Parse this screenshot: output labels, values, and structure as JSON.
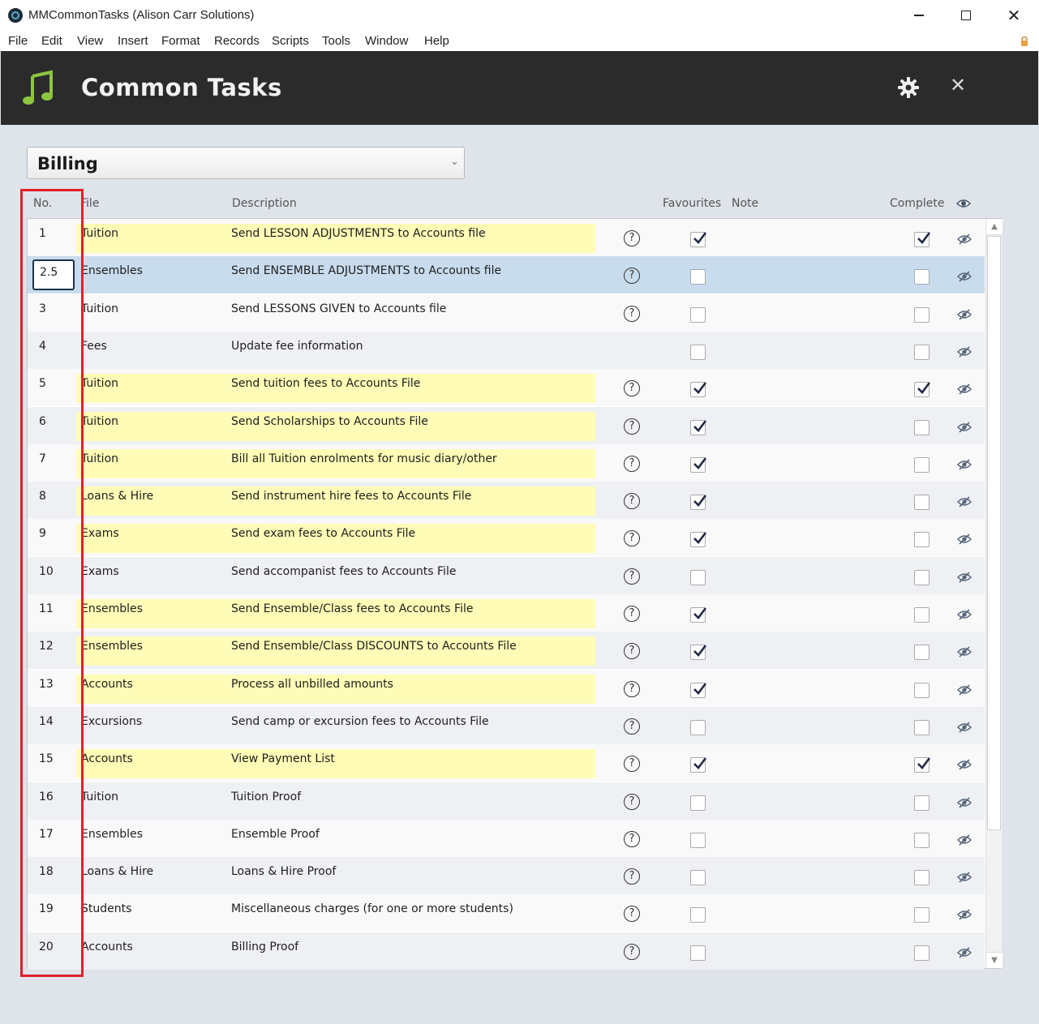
{
  "window": {
    "title": "MMCommonTasks (Alison Carr Solutions)"
  },
  "menu": [
    "File",
    "Edit",
    "View",
    "Insert",
    "Format",
    "Records",
    "Scripts",
    "Tools",
    "Window",
    "Help"
  ],
  "header": {
    "title": "Common Tasks"
  },
  "category_select": {
    "value": "Billing"
  },
  "columns": {
    "no": "No.",
    "file": "File",
    "description": "Description",
    "favourites": "Favourites",
    "note": "Note",
    "complete": "Complete"
  },
  "rows": [
    {
      "no": "1",
      "file": "Tuition",
      "description": "Send LESSON ADJUSTMENTS to Accounts file",
      "highlight": true,
      "help": true,
      "favourite": true,
      "complete": true
    },
    {
      "no": "2.5",
      "file": "Ensembles",
      "description": "Send ENSEMBLE ADJUSTMENTS to Accounts file",
      "highlight": false,
      "help": true,
      "favourite": false,
      "complete": false,
      "selected": true,
      "editing": true
    },
    {
      "no": "3",
      "file": "Tuition",
      "description": "Send LESSONS GIVEN to Accounts file",
      "highlight": false,
      "help": true,
      "favourite": false,
      "complete": false
    },
    {
      "no": "4",
      "file": "Fees",
      "description": "Update fee information",
      "highlight": false,
      "help": false,
      "favourite": false,
      "complete": false
    },
    {
      "no": "5",
      "file": "Tuition",
      "description": "Send tuition fees to Accounts File",
      "highlight": true,
      "help": true,
      "favourite": true,
      "complete": true
    },
    {
      "no": "6",
      "file": "Tuition",
      "description": "Send Scholarships to Accounts File",
      "highlight": true,
      "help": true,
      "favourite": true,
      "complete": false
    },
    {
      "no": "7",
      "file": "Tuition",
      "description": "Bill all Tuition enrolments for music diary/other",
      "highlight": true,
      "help": true,
      "favourite": true,
      "complete": false
    },
    {
      "no": "8",
      "file": "Loans & Hire",
      "description": "Send instrument hire fees to Accounts File",
      "highlight": true,
      "help": true,
      "favourite": true,
      "complete": false
    },
    {
      "no": "9",
      "file": "Exams",
      "description": "Send exam fees to Accounts File",
      "highlight": true,
      "help": true,
      "favourite": true,
      "complete": false
    },
    {
      "no": "10",
      "file": "Exams",
      "description": "Send accompanist fees to Accounts File",
      "highlight": false,
      "help": true,
      "favourite": false,
      "complete": false
    },
    {
      "no": "11",
      "file": "Ensembles",
      "description": "Send Ensemble/Class fees to Accounts File",
      "highlight": true,
      "help": true,
      "favourite": true,
      "complete": false
    },
    {
      "no": "12",
      "file": "Ensembles",
      "description": "Send Ensemble/Class DISCOUNTS to Accounts File",
      "highlight": true,
      "help": true,
      "favourite": true,
      "complete": false
    },
    {
      "no": "13",
      "file": "Accounts",
      "description": "Process all unbilled amounts",
      "highlight": true,
      "help": true,
      "favourite": true,
      "complete": false
    },
    {
      "no": "14",
      "file": "Excursions",
      "description": "Send camp or excursion fees to Accounts File",
      "highlight": false,
      "help": true,
      "favourite": false,
      "complete": false
    },
    {
      "no": "15",
      "file": "Accounts",
      "description": "View Payment List",
      "highlight": true,
      "help": true,
      "favourite": true,
      "complete": true
    },
    {
      "no": "16",
      "file": "Tuition",
      "description": "Tuition Proof",
      "highlight": false,
      "help": true,
      "favourite": false,
      "complete": false
    },
    {
      "no": "17",
      "file": "Ensembles",
      "description": "Ensemble Proof",
      "highlight": false,
      "help": true,
      "favourite": false,
      "complete": false
    },
    {
      "no": "18",
      "file": "Loans & Hire",
      "description": "Loans & Hire Proof",
      "highlight": false,
      "help": true,
      "favourite": false,
      "complete": false
    },
    {
      "no": "19",
      "file": "Students",
      "description": "Miscellaneous charges (for one or more students)",
      "highlight": false,
      "help": true,
      "favourite": false,
      "complete": false
    },
    {
      "no": "20",
      "file": "Accounts",
      "description": "Billing Proof",
      "highlight": false,
      "help": true,
      "favourite": false,
      "complete": false
    }
  ],
  "icons": {
    "app": "app-globe-icon",
    "header": "music-note-icon",
    "settings": "gear-icon",
    "close": "close-icon",
    "help": "help-circle-icon",
    "hide": "eye-slash-icon",
    "show_header": "eye-icon",
    "lock": "lock-icon"
  },
  "colors": {
    "header_bg": "#2b2b2b",
    "accent_green": "#8cc63f",
    "highlight_yellow": "#fefcb6",
    "selected_row": "#c8dcee",
    "annotation_red": "#e0202a"
  }
}
